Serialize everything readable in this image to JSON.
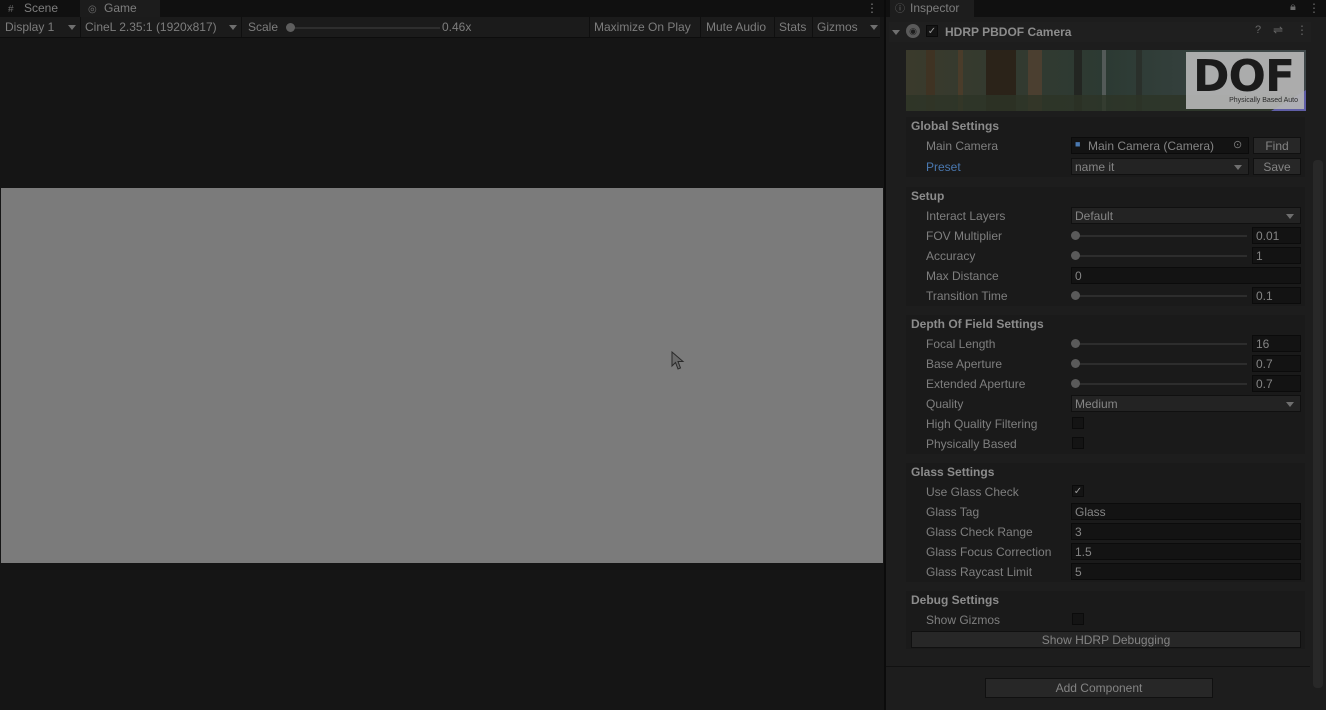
{
  "left_tabs": [
    {
      "label": "Scene",
      "icon": "hash-icon",
      "active": false
    },
    {
      "label": "Game",
      "icon": "gamepad-icon",
      "active": true
    }
  ],
  "game_toolbar": {
    "display": "Display 1",
    "aspect": "CineL 2.35:1 (1920x817)",
    "scale_label": "Scale",
    "scale_value": "0.46x",
    "maximize": "Maximize On Play",
    "mute": "Mute Audio",
    "stats": "Stats",
    "gizmos": "Gizmos"
  },
  "inspector": {
    "tab_label": "Inspector",
    "component_title": "HDRP PBDOF Camera",
    "banner_title": "DOF",
    "banner_subtitle": "Physically Based Auto",
    "global": {
      "title": "Global Settings",
      "main_camera_label": "Main Camera",
      "main_camera_value": "Main Camera (Camera)",
      "find_label": "Find",
      "preset_label": "Preset",
      "preset_value": "name it",
      "save_label": "Save"
    },
    "setup": {
      "title": "Setup",
      "interact_layers_label": "Interact Layers",
      "interact_layers_value": "Default",
      "fov_label": "FOV Multiplier",
      "fov_value": "0.01",
      "accuracy_label": "Accuracy",
      "accuracy_value": "1",
      "max_distance_label": "Max Distance",
      "max_distance_value": "0",
      "transition_label": "Transition Time",
      "transition_value": "0.1"
    },
    "dof": {
      "title": "Depth Of Field Settings",
      "focal_label": "Focal Length",
      "focal_value": "16",
      "base_aperture_label": "Base Aperture",
      "base_aperture_value": "0.7",
      "ext_aperture_label": "Extended Aperture",
      "ext_aperture_value": "0.7",
      "quality_label": "Quality",
      "quality_value": "Medium",
      "hq_filter_label": "High Quality Filtering",
      "hq_filter_checked": false,
      "phys_label": "Physically Based",
      "phys_checked": false
    },
    "glass": {
      "title": "Glass Settings",
      "use_check_label": "Use Glass Check",
      "use_check_checked": true,
      "tag_label": "Glass Tag",
      "tag_value": "Glass",
      "range_label": "Glass Check Range",
      "range_value": "3",
      "focus_label": "Glass Focus Correction",
      "focus_value": "1.5",
      "raycast_label": "Glass Raycast Limit",
      "raycast_value": "5"
    },
    "debug": {
      "title": "Debug Settings",
      "gizmos_label": "Show Gizmos",
      "gizmos_checked": false,
      "hdrp_button": "Show HDRP Debugging"
    },
    "add_component": "Add Component"
  },
  "colors": {
    "preset_label": "#4a78b0",
    "frame": "#7b7b7b"
  }
}
